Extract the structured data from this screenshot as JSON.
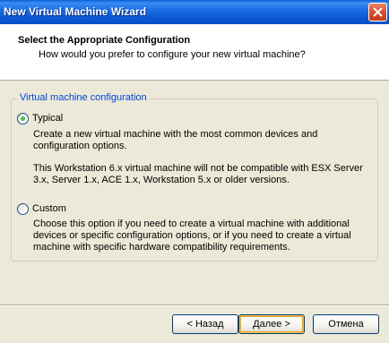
{
  "window": {
    "title": "New Virtual Machine Wizard",
    "close_icon": "close-icon"
  },
  "header": {
    "title": "Select the Appropriate Configuration",
    "subtitle": "How would you prefer to configure your new virtual machine?"
  },
  "config_group": {
    "legend": "Virtual machine configuration",
    "options": [
      {
        "label": "Typical",
        "selected": true,
        "description": "Create a new virtual machine with the most common devices and configuration options.",
        "note": "This Workstation 6.x virtual machine will not be compatible with ESX Server 3.x, Server 1.x, ACE 1.x, Workstation 5.x or older versions."
      },
      {
        "label": "Custom",
        "selected": false,
        "description": "Choose this option if you need to create a virtual machine with additional devices or specific configuration options, or if you need to create a virtual machine with specific hardware compatibility requirements."
      }
    ]
  },
  "buttons": {
    "back": "< Назад",
    "next": "Далее >",
    "cancel": "Отмена"
  },
  "colors": {
    "titlebar": "#0a5fd8",
    "legend": "#0046d5",
    "window_bg": "#ece9d8"
  }
}
